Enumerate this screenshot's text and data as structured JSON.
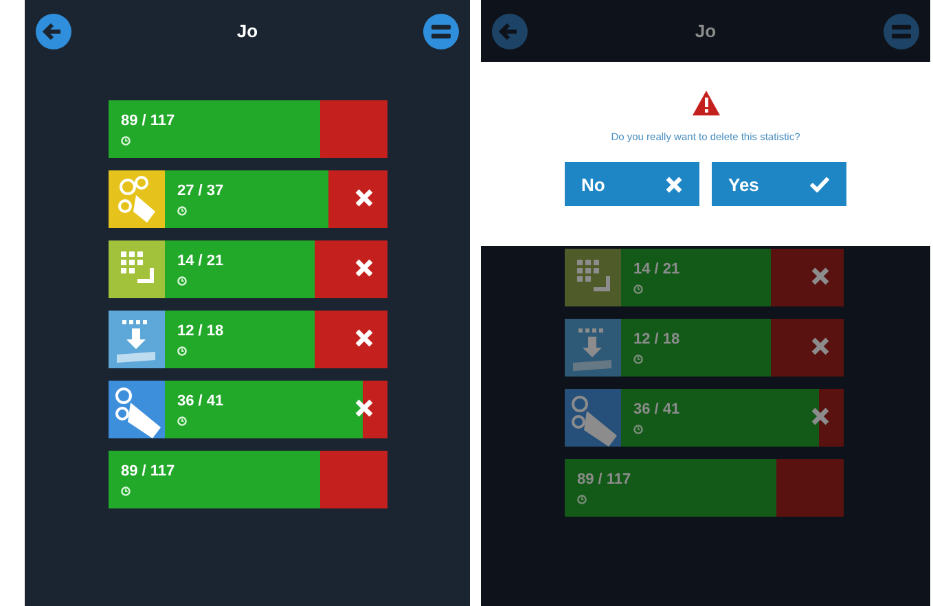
{
  "screens": [
    {
      "title": "Jo",
      "dimmed": false,
      "rows": [
        {
          "score": "89 / 117",
          "level": 0.76,
          "kind": "plain",
          "delete": false
        },
        {
          "score": "27 / 37",
          "level": 0.79,
          "kind": "puzzle",
          "color": "#e6c31c",
          "delete": true
        },
        {
          "score": "14 / 21",
          "level": 0.74,
          "kind": "grid",
          "color": "#a3c23c",
          "delete": true
        },
        {
          "score": "12 / 18",
          "level": 0.74,
          "kind": "download",
          "color": "#5da8d8",
          "delete": true
        },
        {
          "score": "36 / 41",
          "level": 0.91,
          "kind": "hand",
          "color": "#3d8fdc",
          "delete": true
        },
        {
          "score": "89 / 117",
          "level": 0.76,
          "kind": "plain",
          "delete": false
        }
      ]
    },
    {
      "title": "Jo",
      "dimmed": true,
      "dialog": {
        "message": "Do you really want to delete this statistic?",
        "buttons": [
          {
            "label": "No",
            "kind": "cancel"
          },
          {
            "label": "Yes",
            "kind": "confirm"
          }
        ]
      },
      "rows": [
        {
          "score": "14 / 21",
          "level": 0.74,
          "kind": "grid",
          "color": "#4f5c2a",
          "delete": true
        },
        {
          "score": "12 / 18",
          "level": 0.74,
          "kind": "download",
          "color": "#2e5a78",
          "delete": true
        },
        {
          "score": "36 / 41",
          "level": 0.91,
          "kind": "hand",
          "color": "#26507a",
          "delete": true
        },
        {
          "score": "89 / 117",
          "level": 0.76,
          "kind": "plain",
          "delete": false
        }
      ]
    }
  ]
}
